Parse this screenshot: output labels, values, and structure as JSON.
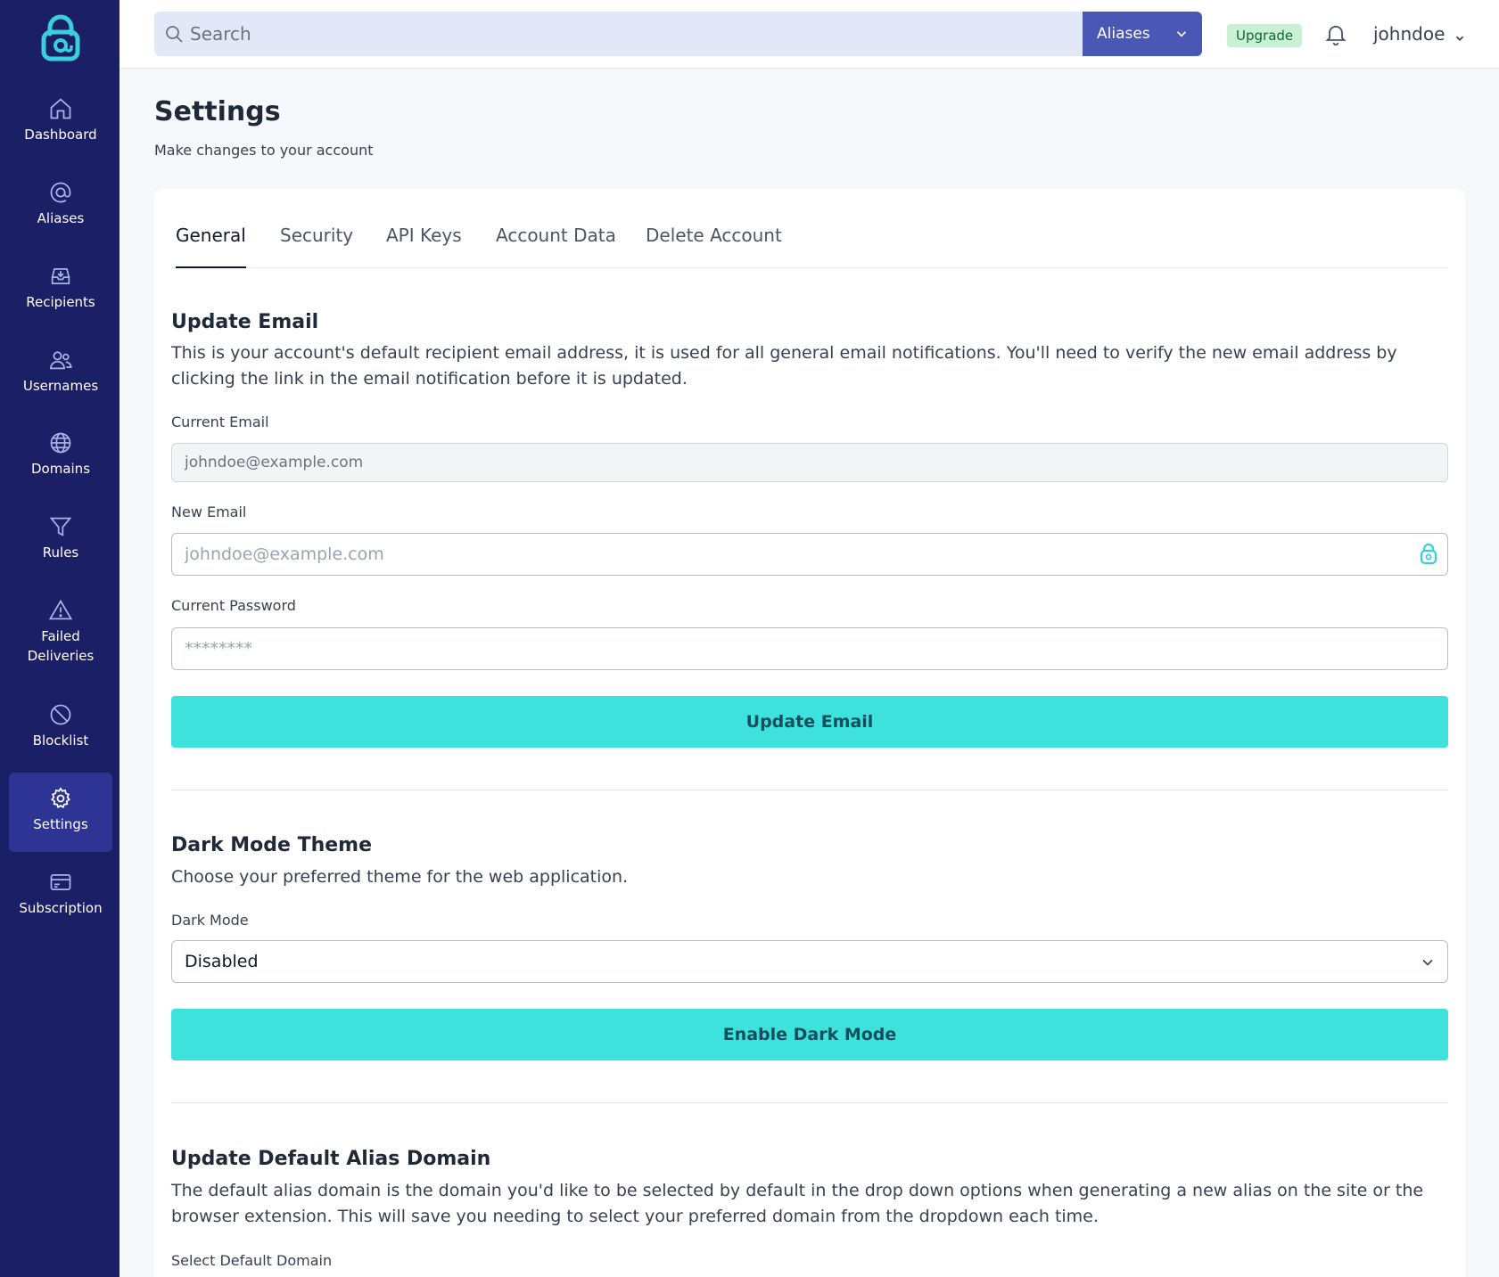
{
  "sidebar": {
    "items": [
      {
        "label": "Dashboard",
        "icon": "home-icon"
      },
      {
        "label": "Aliases",
        "icon": "at-sign-icon"
      },
      {
        "label": "Recipients",
        "icon": "inbox-icon"
      },
      {
        "label": "Usernames",
        "icon": "users-icon"
      },
      {
        "label": "Domains",
        "icon": "globe-icon"
      },
      {
        "label": "Rules",
        "icon": "filter-icon"
      },
      {
        "label": "Failed Deliveries",
        "icon": "warning-icon"
      },
      {
        "label": "Blocklist",
        "icon": "ban-icon"
      },
      {
        "label": "Settings",
        "icon": "gear-icon",
        "active": true
      },
      {
        "label": "Subscription",
        "icon": "credit-card-icon"
      }
    ]
  },
  "topbar": {
    "search_placeholder": "Search",
    "search_scope": "Aliases",
    "upgrade_label": "Upgrade",
    "username": "johndoe"
  },
  "page": {
    "title": "Settings",
    "subtitle": "Make changes to your account"
  },
  "tabs": [
    {
      "label": "General",
      "active": true
    },
    {
      "label": "Security"
    },
    {
      "label": "API Keys"
    },
    {
      "label": "Account Data"
    },
    {
      "label": "Delete Account"
    }
  ],
  "update_email": {
    "title": "Update Email",
    "description": "This is your account's default recipient email address, it is used for all general email notifications. You'll need to verify the new email address by clicking the link in the email notification before it is updated.",
    "current_email_label": "Current Email",
    "current_email_value": "johndoe@example.com",
    "new_email_label": "New Email",
    "new_email_placeholder": "johndoe@example.com",
    "current_password_label": "Current Password",
    "current_password_placeholder": "********",
    "button_label": "Update Email"
  },
  "dark_mode": {
    "title": "Dark Mode Theme",
    "description": "Choose your preferred theme for the web application.",
    "select_label": "Dark Mode",
    "selected_value": "Disabled",
    "button_label": "Enable Dark Mode"
  },
  "default_domain": {
    "title": "Update Default Alias Domain",
    "description": "The default alias domain is the domain you'd like to be selected by default in the drop down options when generating a new alias on the site or the browser extension. This will save you needing to select your preferred domain from the dropdown each time.",
    "select_label": "Select Default Domain"
  },
  "colors": {
    "sidebar_bg": "#1b1f66",
    "sidebar_active": "#2d3494",
    "accent_button": "#3ee2dc",
    "scope_button": "#4a57b5",
    "logo": "#38d0dd"
  }
}
